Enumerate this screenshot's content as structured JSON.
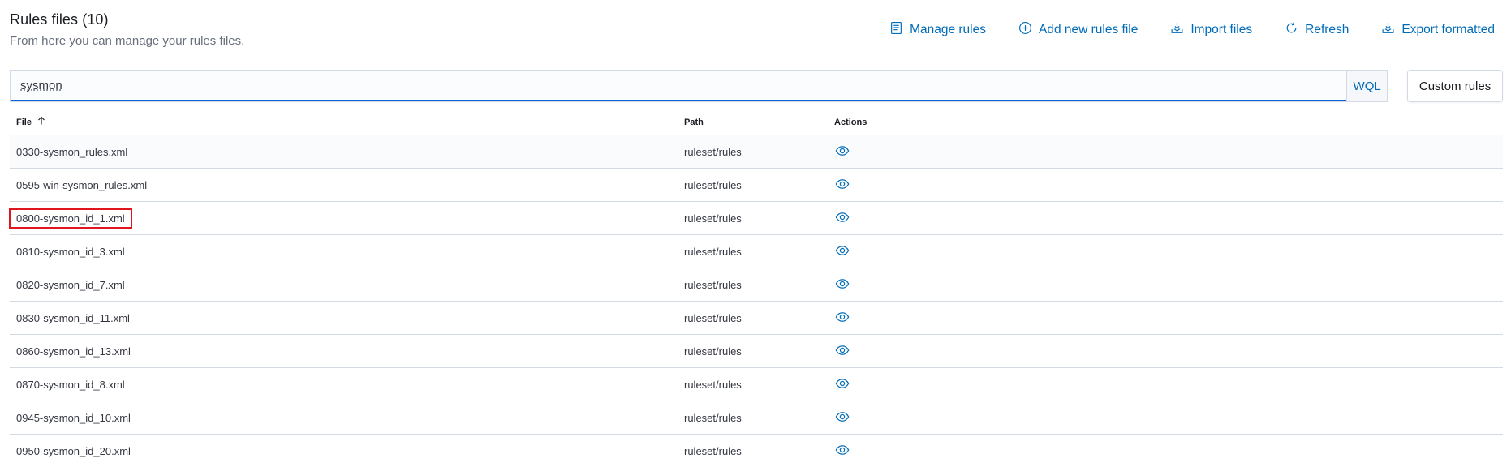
{
  "header": {
    "title": "Rules files (10)",
    "subtitle": "From here you can manage your rules files."
  },
  "toolbar": {
    "manage_rules": "Manage rules",
    "add_new_rules_file": "Add new rules file",
    "import_files": "Import files",
    "refresh": "Refresh",
    "export_formatted": "Export formatted"
  },
  "search": {
    "value": "sysmon",
    "wql_label": "WQL",
    "custom_rules_label": "Custom rules"
  },
  "table": {
    "columns": {
      "file": "File",
      "path": "Path",
      "actions": "Actions"
    },
    "sort": "ascending",
    "rows": [
      {
        "file": "0330-sysmon_rules.xml",
        "path": "ruleset/rules"
      },
      {
        "file": "0595-win-sysmon_rules.xml",
        "path": "ruleset/rules"
      },
      {
        "file": "0800-sysmon_id_1.xml",
        "path": "ruleset/rules"
      },
      {
        "file": "0810-sysmon_id_3.xml",
        "path": "ruleset/rules"
      },
      {
        "file": "0820-sysmon_id_7.xml",
        "path": "ruleset/rules"
      },
      {
        "file": "0830-sysmon_id_11.xml",
        "path": "ruleset/rules"
      },
      {
        "file": "0860-sysmon_id_13.xml",
        "path": "ruleset/rules"
      },
      {
        "file": "0870-sysmon_id_8.xml",
        "path": "ruleset/rules"
      },
      {
        "file": "0945-sysmon_id_10.xml",
        "path": "ruleset/rules"
      },
      {
        "file": "0950-sysmon_id_20.xml",
        "path": "ruleset/rules"
      }
    ]
  },
  "highlight": {
    "row_index": 2,
    "color": "#e0161f"
  },
  "colors": {
    "accent": "#006bb8",
    "border": "#d3dae6"
  }
}
